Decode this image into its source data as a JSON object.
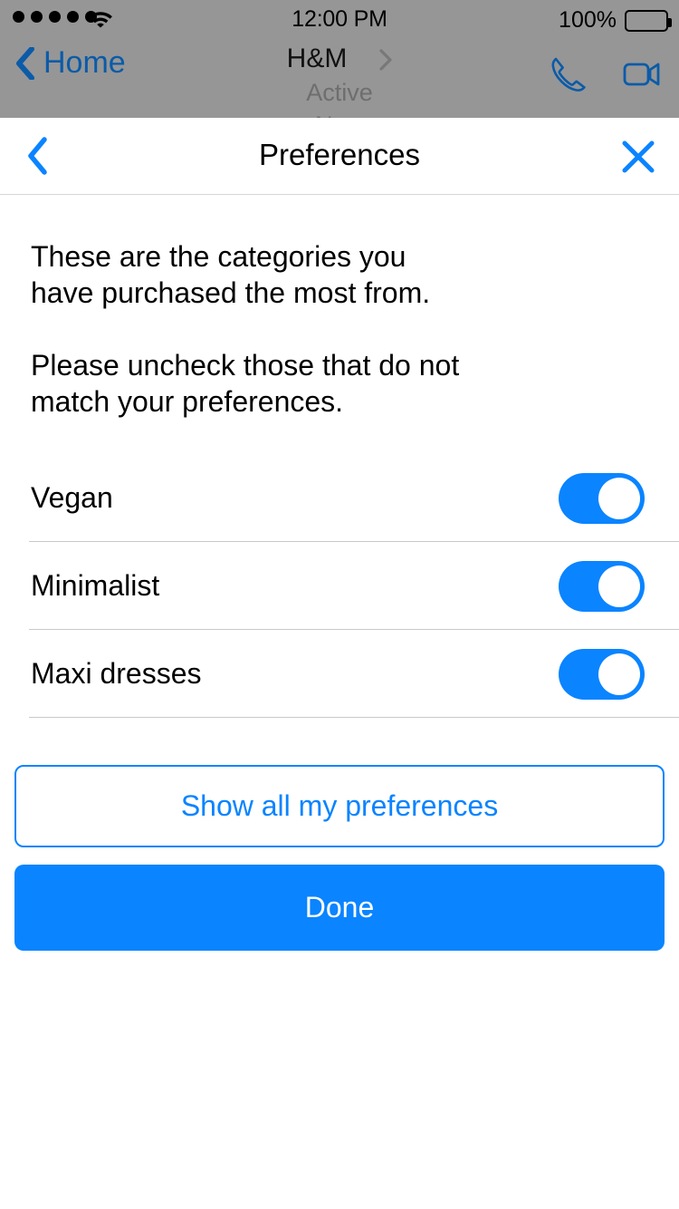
{
  "status_bar": {
    "signal_dots": 5,
    "wifi_icon": "wifi-icon",
    "time": "12:00 PM",
    "battery_percent": "100%",
    "battery_icon": "battery-full-icon"
  },
  "messenger_nav": {
    "back_icon": "chevron-left-icon",
    "back_label": "Home",
    "contact_name": "H&M",
    "disclosure_icon": "chevron-right-icon",
    "status_line1": "Active",
    "status_line2": "Now",
    "call_icon": "phone-icon",
    "video_icon": "video-camera-icon"
  },
  "sheet": {
    "back_icon": "chevron-left-icon",
    "title": "Preferences",
    "close_icon": "close-x-icon",
    "intro": {
      "paragraph1": "These are the categories you have purchased the most from.",
      "paragraph2": "Please uncheck those that do not match your preferences."
    },
    "preferences": [
      {
        "label": "Vegan",
        "enabled": true
      },
      {
        "label": "Minimalist",
        "enabled": true
      },
      {
        "label": "Maxi dresses",
        "enabled": true
      }
    ],
    "buttons": {
      "secondary": "Show all my preferences",
      "primary": "Done"
    }
  },
  "colors": {
    "accent": "#0a84ff",
    "dim_overlay": "#969696",
    "separator": "#c9c9c9",
    "muted_text": "#6e6e6e"
  }
}
